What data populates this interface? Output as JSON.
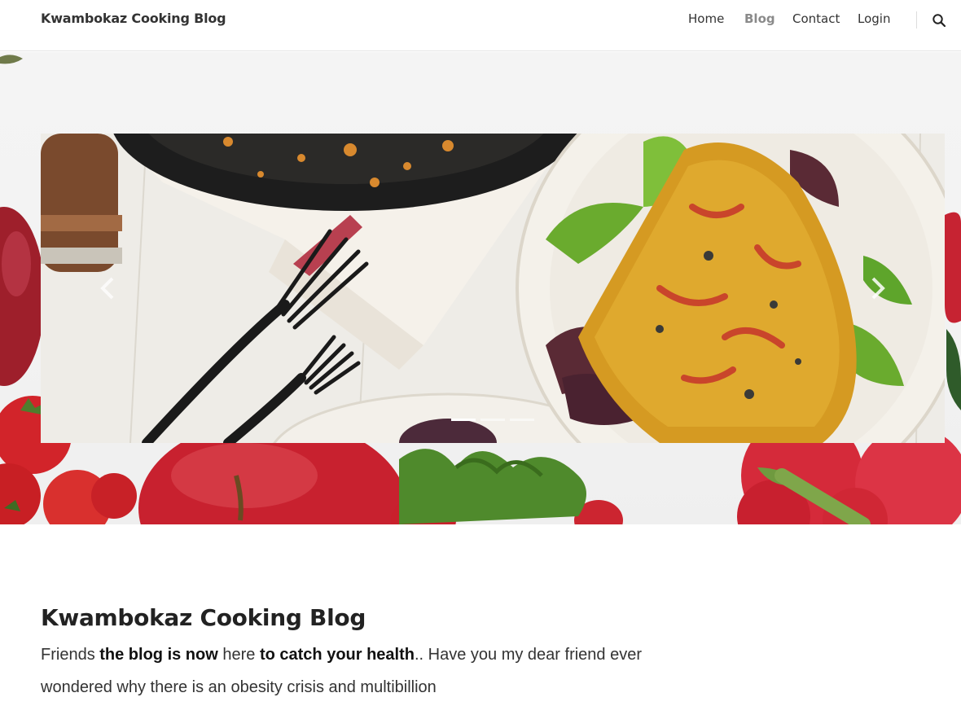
{
  "nav": {
    "brand": "Kwambokaz Cooking Blog",
    "links": [
      {
        "label": "Home"
      },
      {
        "label": "Blog"
      },
      {
        "label": "Contact"
      },
      {
        "label": "Login"
      }
    ],
    "active_link": "Blog"
  },
  "carousel": {
    "slide_count": 3,
    "active_slide": 1
  },
  "content": {
    "title": "Kwambokaz Cooking Blog",
    "intro_parts": [
      {
        "text": "Friends ",
        "bold": false
      },
      {
        "text": "the blog is now",
        "bold": true
      },
      {
        "text": " here ",
        "bold": false
      },
      {
        "text": "to catch your health",
        "bold": true
      },
      {
        "text": ".. Have you my dear friend ever wondered why there is an obesity crisis and multibillion",
        "bold": false
      }
    ]
  },
  "colors": {
    "active_nav": "#8a8a8a",
    "text": "#333333",
    "navbar_border": "#e3e3e3"
  }
}
